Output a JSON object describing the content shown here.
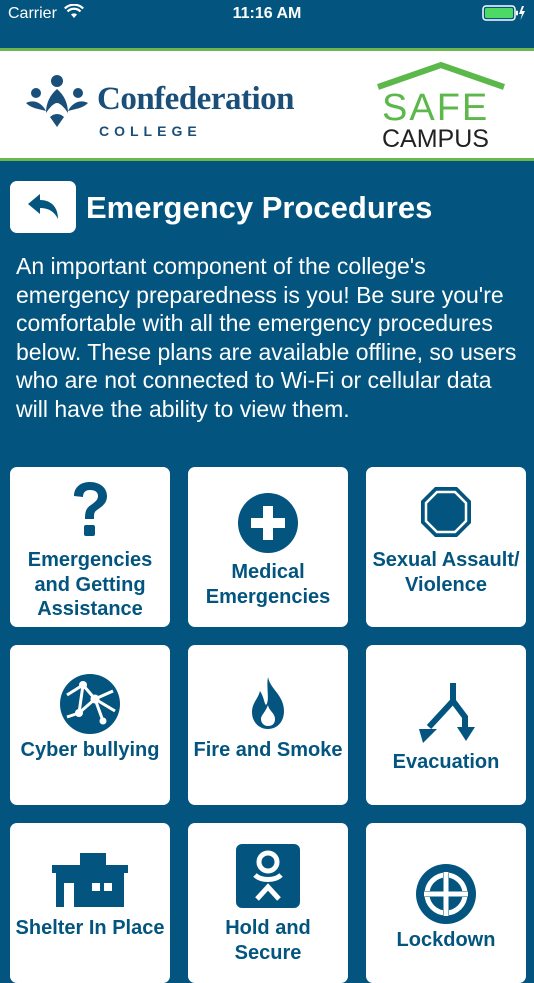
{
  "status_bar": {
    "carrier": "Carrier",
    "time": "11:16 AM"
  },
  "header": {
    "college_name": "Confederation",
    "college_sub": "COLLEGE",
    "safe": "SAFE",
    "campus": "CAMPUS"
  },
  "page": {
    "title": "Emergency Procedures",
    "intro": "An important component of the college's emergency preparedness is you! Be sure you're comfortable with all the emergency procedures below. These plans are available offline, so users who are not connected to Wi-Fi or cellular data will have the ability to view them."
  },
  "tiles": [
    {
      "label": "Emergencies and Getting Assistance",
      "icon": "question-icon"
    },
    {
      "label": "Medical Emergencies",
      "icon": "medical-plus-icon"
    },
    {
      "label": "Sexual Assault/ Violence",
      "icon": "octagon-icon"
    },
    {
      "label": "Cyber bullying",
      "icon": "globe-network-icon"
    },
    {
      "label": "Fire and Smoke",
      "icon": "flame-icon"
    },
    {
      "label": "Evacuation",
      "icon": "split-arrows-icon"
    },
    {
      "label": "Shelter In Place",
      "icon": "building-icon"
    },
    {
      "label": "Hold and Secure",
      "icon": "figure-badge-icon"
    },
    {
      "label": "Lockdown",
      "icon": "crosshair-icon"
    }
  ],
  "colors": {
    "primary": "#03557f",
    "accent_green": "#5cb84a",
    "tile_bg": "#ffffff"
  }
}
